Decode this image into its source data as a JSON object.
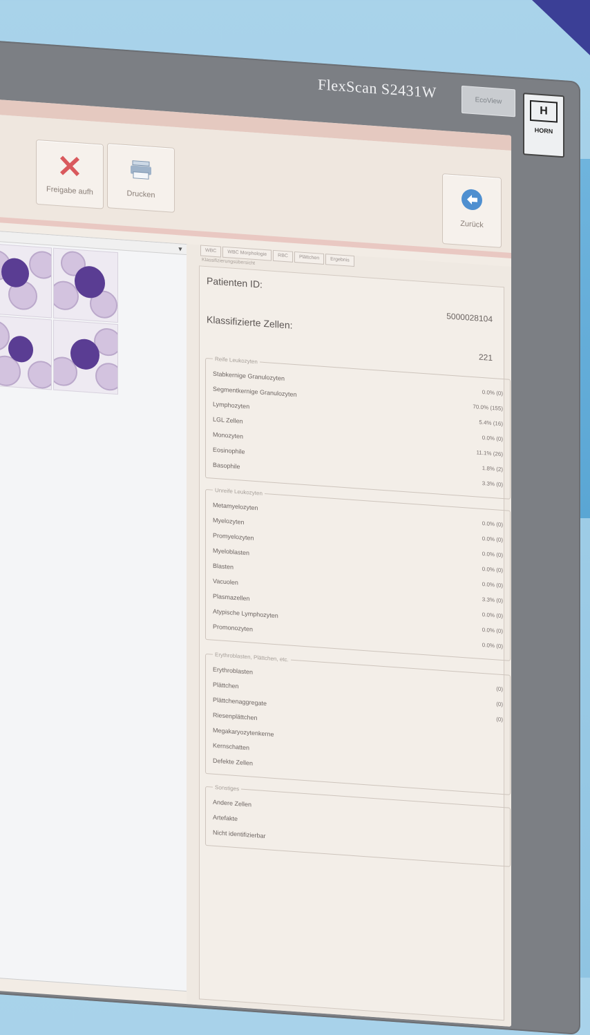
{
  "monitor": {
    "brand": "FlexScan S2431W",
    "badge": "EcoView",
    "logo_letter": "H",
    "logo_text": "HORN"
  },
  "toolbar": {
    "freigabe_label": "Freigabe aufh",
    "drucken_label": "Drucken",
    "zurueck_label": "Zurück"
  },
  "tabs": [
    "WBC",
    "WBC Morphologie",
    "RBC",
    "Plättchen",
    "Ergebnis"
  ],
  "tab_subtitle": "Klassifizierungsübersicht",
  "patient": {
    "id_label": "Patienten ID:",
    "id_value": "5000028104",
    "classified_label": "Klassifizierte Zellen:",
    "classified_value": "221"
  },
  "groups": {
    "reife": {
      "legend": "Reife Leukozyten",
      "rows": [
        {
          "label": "Stabkernige Granulozyten",
          "value": "0.0% (0)"
        },
        {
          "label": "Segmentkernige Granulozyten",
          "value": "70.0% (155)"
        },
        {
          "label": "Lymphozyten",
          "value": "5.4% (16)"
        },
        {
          "label": "LGL Zellen",
          "value": "0.0% (0)"
        },
        {
          "label": "Monozyten",
          "value": "11.1% (26)"
        },
        {
          "label": "Eosinophile",
          "value": "1.8% (2)"
        },
        {
          "label": "Basophile",
          "value": "3.3% (0)"
        }
      ]
    },
    "unreife": {
      "legend": "Unreife Leukozyten",
      "rows": [
        {
          "label": "Metamyelozyten",
          "value": "0.0% (0)"
        },
        {
          "label": "Myelozyten",
          "value": "0.0% (0)"
        },
        {
          "label": "Promyelozyten",
          "value": "0.0% (0)"
        },
        {
          "label": "Myeloblasten",
          "value": "0.0% (0)"
        },
        {
          "label": "Blasten",
          "value": "0.0% (0)"
        },
        {
          "label": "Vacuolen",
          "value": "3.3% (0)"
        },
        {
          "label": "Plasmazellen",
          "value": "0.0% (0)"
        },
        {
          "label": "Atypische Lymphozyten",
          "value": "0.0% (0)"
        },
        {
          "label": "Promonozyten",
          "value": "0.0% (0)"
        }
      ]
    },
    "erythro": {
      "legend": "Erythroblasten, Plättchen, etc.",
      "rows": [
        {
          "label": "Erythroblasten",
          "value": "(0)"
        },
        {
          "label": "Plättchen",
          "value": "(0)"
        },
        {
          "label": "Plättchenaggregate",
          "value": "(0)"
        },
        {
          "label": "Riesenplättchen",
          "value": ""
        },
        {
          "label": "Megakaryozytenkerne",
          "value": ""
        },
        {
          "label": "Kernschatten",
          "value": ""
        },
        {
          "label": "Defekte Zellen",
          "value": ""
        }
      ]
    },
    "sonstiges": {
      "legend": "Sonstiges",
      "rows": [
        {
          "label": "Andere Zellen",
          "value": ""
        },
        {
          "label": "Artefakte",
          "value": ""
        },
        {
          "label": "Nicht identifizierbar",
          "value": ""
        }
      ]
    }
  }
}
